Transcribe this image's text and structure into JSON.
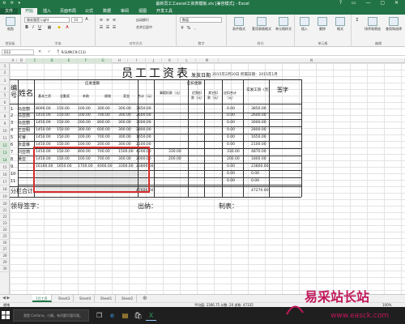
{
  "window": {
    "title": "最新员工工excel工资表模板.xls [兼容模式] - Excel",
    "quick_access": "⟲ ⟳ ▾",
    "controls": "? ▭ — ▢ ✕"
  },
  "tabs": [
    "文件",
    "开始",
    "插入",
    "页面布局",
    "公式",
    "数据",
    "审阅",
    "视图",
    "开发工具"
  ],
  "ribbon": {
    "paste": "粘贴",
    "font_name": "微软雅黑 Light",
    "font_size": "14",
    "groups": {
      "clipboard": "剪贴板",
      "font": "字体",
      "align": "对齐方式",
      "number": "数字",
      "styles": "样式",
      "cells": "单元格",
      "editing": "编辑"
    },
    "wrap": "自动换行",
    "merge": "合并后居中",
    "number_format": "数值",
    "cond_format": "条件格式",
    "table_format": "套用表格格式",
    "cell_styles": "单元格样式",
    "insert": "插入",
    "delete": "删除",
    "format": "格式",
    "sort_filter": "排序和筛选",
    "find_select": "查找和选择"
  },
  "formula_bar": {
    "name_box": "D12",
    "formula": "=SUM(C9:C13)"
  },
  "columns": [
    "A",
    "B",
    "C",
    "D",
    "E",
    "F",
    "G",
    "H",
    "I",
    "J",
    "K",
    "L",
    "M",
    "N"
  ],
  "rows": [
    "1",
    "2",
    "3",
    "4",
    "5",
    "6",
    "7",
    "8",
    "9",
    "10",
    "11",
    "12",
    "13",
    "14",
    "15",
    "16",
    "17",
    "18",
    "19",
    "20",
    "21",
    "22",
    "23",
    "24",
    "25",
    "26",
    "27",
    "28",
    "29",
    "30"
  ],
  "sheet": {
    "title": "员工工资表",
    "issue_label": "发放日期",
    "issue_value": "2015年2月10日  所属日期：2015年1月",
    "h_no": "编号",
    "h_name": "姓名",
    "h_should": "应发金额",
    "h_basic": "基本工资",
    "h_allow": "全勤奖",
    "h_subsidy": "补助",
    "h_other": "绩效",
    "h_bonus": "奖金",
    "h_total": "合计（元）",
    "h_deduct": "应扣金额",
    "h_ded1": "事假扣款（元）",
    "h_ded2": "迟到扣款（元）",
    "h_ded3": "其它扣款（元）",
    "h_dedsum": "应扣合计（元）",
    "h_actual": "实发工资（元）",
    "h_sign": "签字",
    "subtotal": "分栏合计",
    "signers": [
      "领导签字：",
      "出纳：",
      "制表："
    ],
    "rows": [
      {
        "no": "1",
        "name": "马亚丽",
        "c": [
          "8000.00",
          "150.00",
          "100.00",
          "300.00",
          "300.00",
          "3850.00"
        ],
        "d": "",
        "ds": "0.00",
        "act": "3850.00"
      },
      {
        "no": "2",
        "name": "马亚南",
        "c": [
          "1450.00",
          "150.00",
          "100.00",
          "700.00",
          "300.00",
          "2600.00"
        ],
        "d": "",
        "ds": "0.00",
        "act": "2600.00"
      },
      {
        "no": "3",
        "name": "马亚丽",
        "c": [
          "1450.00",
          "150.00",
          "200.00",
          "800.00",
          "300.00",
          "3000.00"
        ],
        "d": "",
        "ds": "0.00",
        "act": "3000.00"
      },
      {
        "no": "4",
        "name": "王亚明",
        "c": [
          "1450.00",
          "150.00",
          "300.00",
          "600.00",
          "300.00",
          "2800.00"
        ],
        "d": "",
        "ds": "0.00",
        "act": "2800.00"
      },
      {
        "no": "5",
        "name": "可睿",
        "c": [
          "1450.00",
          "150.00",
          "100.00",
          "700.00",
          "300.00",
          "1650.00"
        ],
        "d": "",
        "ds": "0.00",
        "act": "1650.00"
      },
      {
        "no": "6",
        "name": "张曼琳",
        "c": [
          "1450.00",
          "150.00",
          "100.00",
          "200.00",
          "300.00",
          "2100.00"
        ],
        "d": "",
        "ds": "0.00",
        "act": "2100.00"
      },
      {
        "no": "7",
        "name": "刘亚琦",
        "c": [
          "1450.00",
          "150.00",
          "800.00",
          "700.00",
          "1500.00",
          "4200.00"
        ],
        "d": "330.00",
        "ds": "330.00",
        "act": "4870.00"
      },
      {
        "no": "8",
        "name": "黄亚",
        "c": [
          "1450.00",
          "150.00",
          "100.00",
          "700.00",
          "300.00",
          "2000.00"
        ],
        "d": "200.00",
        "ds": "200.00",
        "act": "1800.00"
      },
      {
        "no": "9",
        "name": "",
        "c": [
          "16160.00",
          "1650.00",
          "1700.00",
          "4000.00",
          "3300.00",
          "23800.00"
        ],
        "d": "",
        "ds": "0.00",
        "act": "23800.00"
      },
      {
        "no": "10",
        "name": "",
        "c": [
          "",
          "",
          "",
          "",
          "",
          ""
        ],
        "d": "",
        "ds": "0.00",
        "act": "0.00"
      },
      {
        "no": "11",
        "name": "",
        "c": [
          "",
          "",
          "",
          "",
          "",
          ""
        ],
        "d": "",
        "ds": "0.00",
        "act": "0.00"
      }
    ],
    "subtotal_total": "47600.00",
    "subtotal_actual": "47270.00"
  },
  "sheet_tabs": [
    "1月工资",
    "Sheet3",
    "Sheet4",
    "Sheet1",
    "Sheet2"
  ],
  "status": {
    "left": "就绪",
    "mid": "平均值: 2366.75  计数: 20  求和: 47335",
    "zoom": "100%"
  },
  "taskbar": {
    "search": "我是 Cortana，小娜。有问题尽管问我。"
  },
  "watermark": {
    "text": "易采站长站",
    "url": "www.easck.com"
  },
  "colors": {
    "excel_green": "#217346",
    "selection_red": "#d82c2c"
  }
}
